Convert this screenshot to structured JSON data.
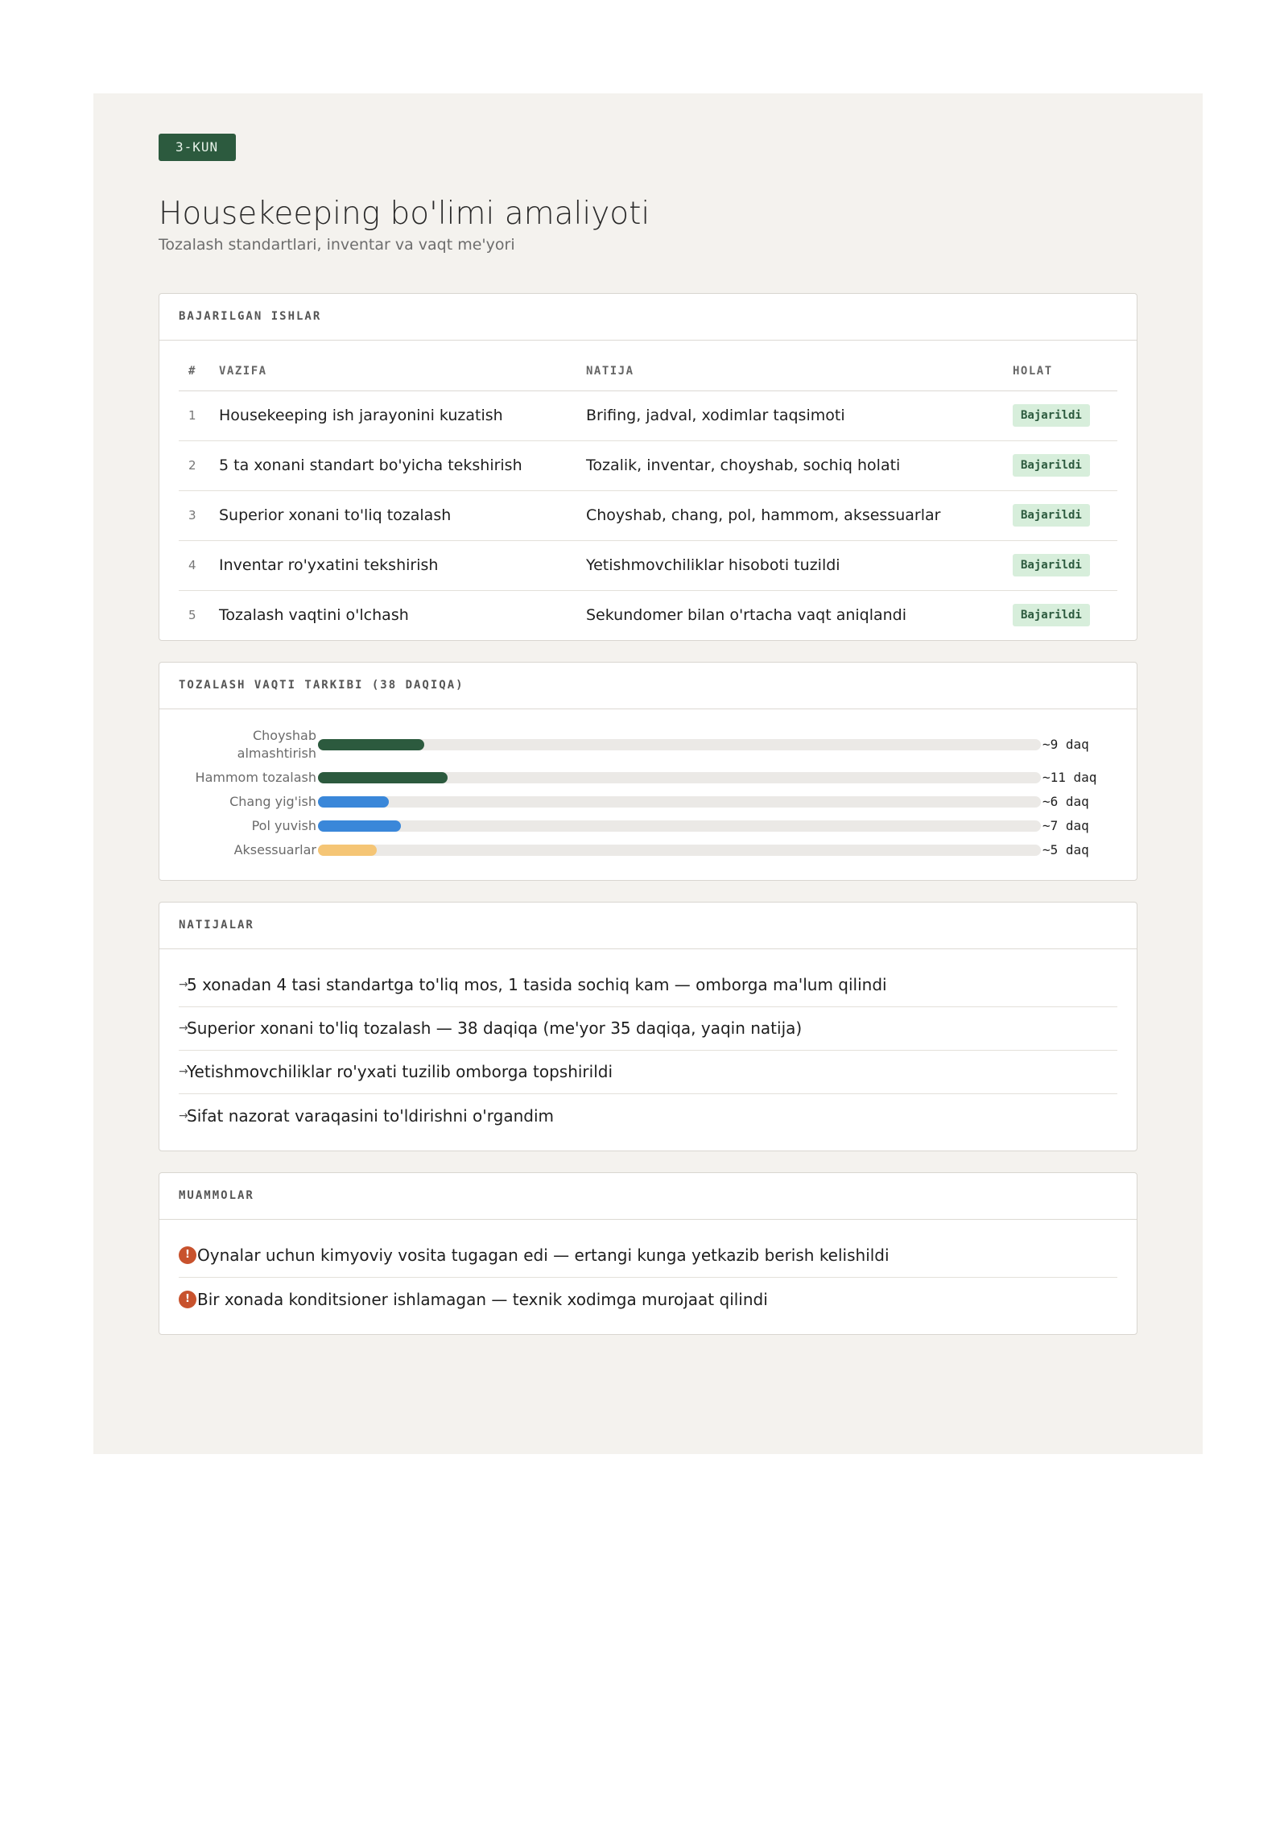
{
  "header": {
    "badge": "3-KUN",
    "title": "Housekeeping bo'limi amaliyoti",
    "subtitle": "Tozalash standartlari, inventar va vaqt me'yori"
  },
  "tasks": {
    "section_title": "BAJARILGAN ISHLAR",
    "columns": [
      "#",
      "VAZIFA",
      "NATIJA",
      "HOLAT"
    ],
    "rows": [
      {
        "num": "1",
        "task": "Housekeeping ish jarayonini kuzatish",
        "result": "Brifing, jadval, xodimlar taqsimoti",
        "status": "Bajarildi"
      },
      {
        "num": "2",
        "task": "5 ta xonani standart bo'yicha tekshirish",
        "result": "Tozalik, inventar, choyshab, sochiq holati",
        "status": "Bajarildi"
      },
      {
        "num": "3",
        "task": "Superior xonani to'liq tozalash",
        "result": "Choyshab, chang, pol, hammom, aksessuarlar",
        "status": "Bajarildi"
      },
      {
        "num": "4",
        "task": "Inventar ro'yxatini tekshirish",
        "result": "Yetishmovchiliklar hisoboti tuzildi",
        "status": "Bajarildi"
      },
      {
        "num": "5",
        "task": "Tozalash vaqtini o'lchash",
        "result": "Sekundomer bilan o'rtacha vaqt aniqlandi",
        "status": "Bajarildi"
      }
    ]
  },
  "time_breakdown": {
    "section_title": "TOZALASH VAQTI TARKIBI (38 DAQIQA)"
  },
  "chart_data": {
    "type": "bar",
    "orientation": "horizontal",
    "title": "TOZALASH VAQTI TARKIBI (38 DAQIQA)",
    "categories": [
      "Choyshab almashtirish",
      "Hammom tozalash",
      "Chang yig'ish",
      "Pol yuvish",
      "Aksessuarlar"
    ],
    "values": [
      9,
      11,
      6,
      7,
      5
    ],
    "value_labels": [
      "~9 daq",
      "~11 daq",
      "~6 daq",
      "~7 daq",
      "~5 daq"
    ],
    "colors": [
      "#2c5a3e",
      "#2c5a3e",
      "#3a87d9",
      "#3a87d9",
      "#f5c575"
    ],
    "xlim": [
      0,
      38
    ],
    "grid": false
  },
  "results": {
    "section_title": "NATIJALAR",
    "arrow_icon": "→",
    "items": [
      "5 xonadan 4 tasi standartga to'liq mos, 1 tasida sochiq kam — omborga ma'lum qilindi",
      "Superior xonani to'liq tozalash — 38 daqiqa (me'yor 35 daqiqa, yaqin natija)",
      "Yetishmovchiliklar ro'yxati tuzilib omborga topshirildi",
      "Sifat nazorat varaqasini to'ldirishni o'rgandim"
    ]
  },
  "problems": {
    "section_title": "MUAMMOLAR",
    "warn_icon": "!",
    "items": [
      "Oynalar uchun kimyoviy vosita tugagan edi — ertangi kunga yetkazib berish kelishildi",
      "Bir xonada konditsioner ishlamagan — texnik xodimga murojaat qilindi"
    ]
  }
}
